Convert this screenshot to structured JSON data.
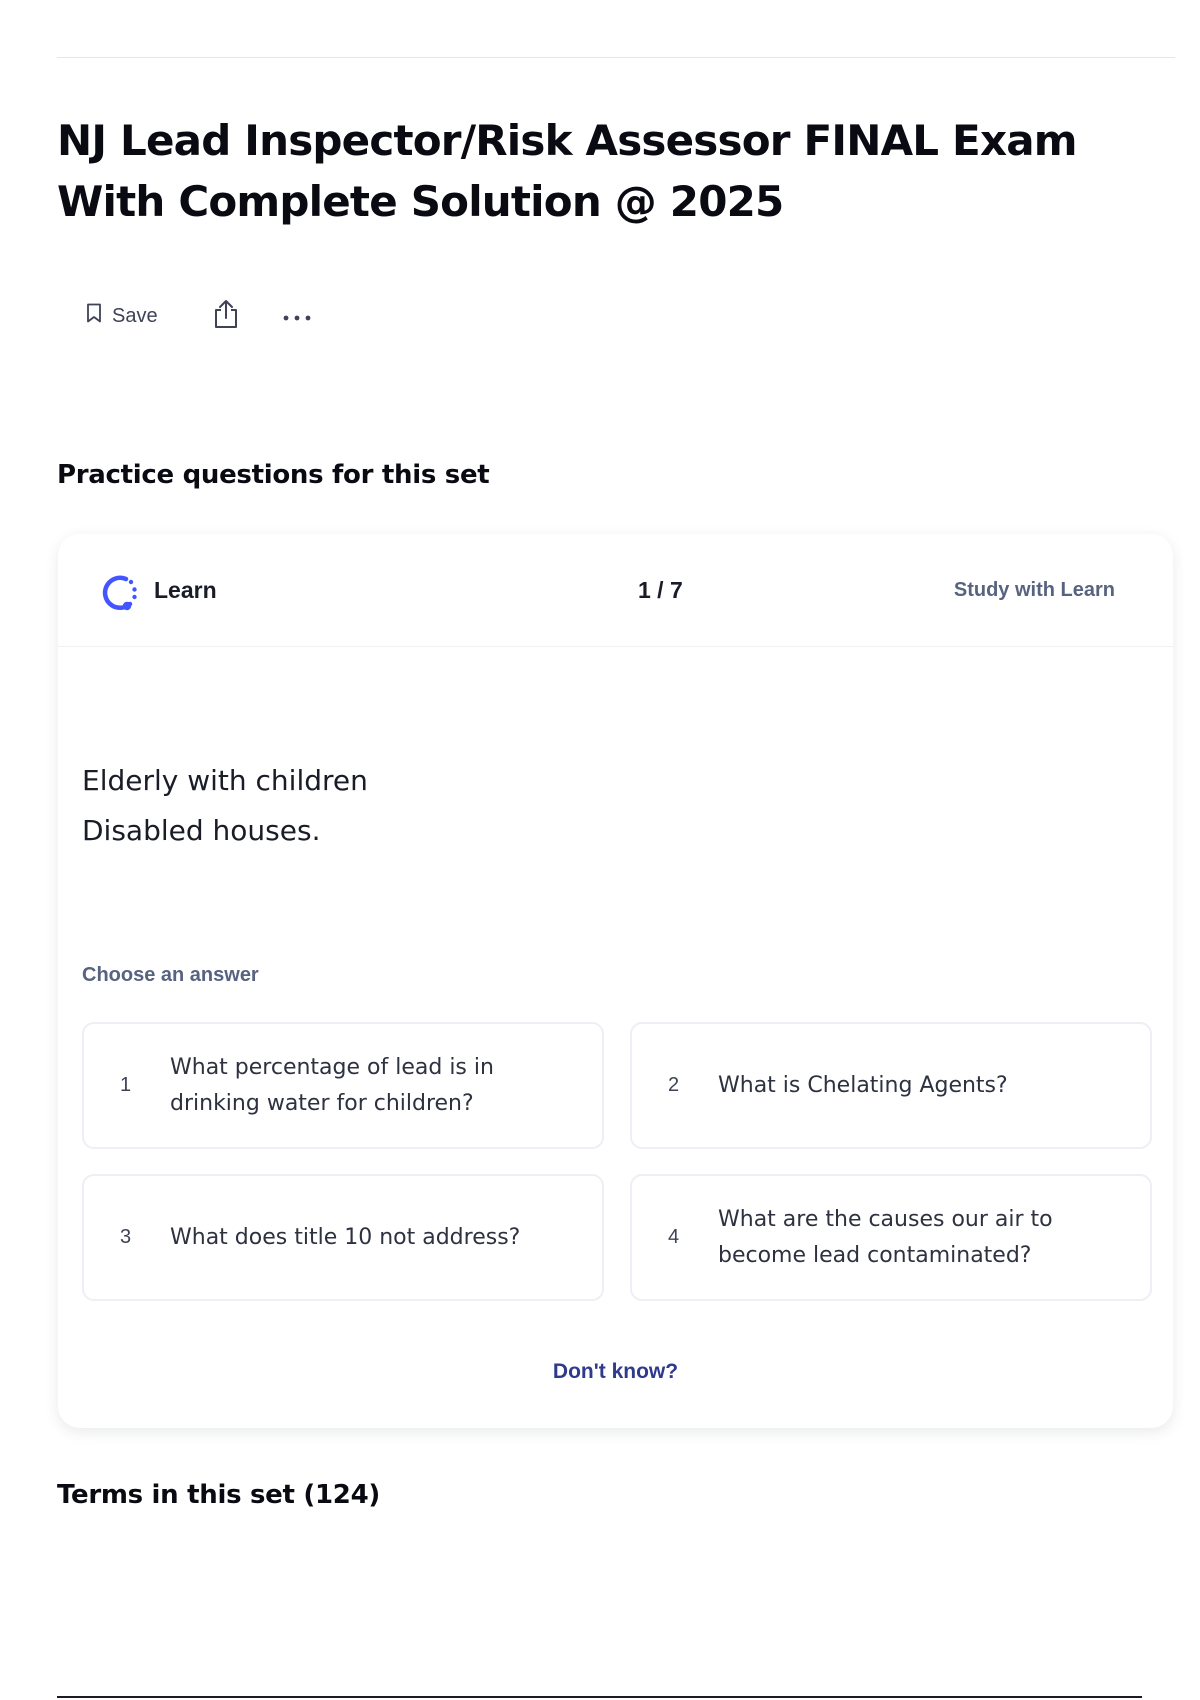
{
  "page": {
    "title": "NJ Lead Inspector/Risk Assessor FINAL Exam With Complete Solution @ 2025"
  },
  "actions": {
    "save_label": "Save",
    "save_icon": "bookmark-icon",
    "share_icon": "share-icon",
    "more_icon": "more-horizontal-icon"
  },
  "practice": {
    "heading": "Practice questions for this set",
    "card": {
      "mode_label": "Learn",
      "mode_icon": "learn-progress-icon",
      "progress": "1 / 7",
      "study_link": "Study with Learn",
      "prompt_lines": [
        "Elderly with children",
        "Disabled houses."
      ],
      "choose_label": "Choose an answer",
      "options": [
        {
          "number": "1",
          "text": "What percentage of lead is in drinking water for children?"
        },
        {
          "number": "2",
          "text": "What is Chelating Agents?"
        },
        {
          "number": "3",
          "text": "What does title 10 not address?"
        },
        {
          "number": "4",
          "text": "What are the causes our air to become lead contaminated?"
        }
      ],
      "dont_know": "Don't know?"
    }
  },
  "terms": {
    "heading": "Terms in this set (124)"
  },
  "colors": {
    "accent_blue": "#4255ff",
    "link_navy": "#2e3a8c",
    "muted_text": "#586380",
    "card_border": "#edeff4"
  }
}
